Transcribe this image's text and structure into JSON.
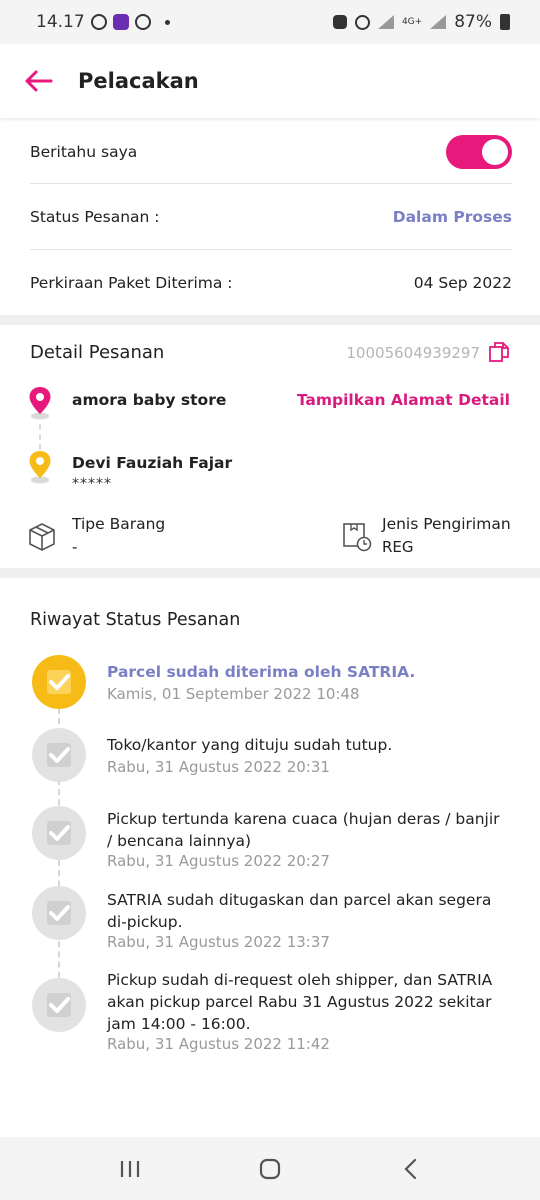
{
  "status_bar": {
    "time": "14.17",
    "network": "4G+",
    "battery": "87%"
  },
  "header": {
    "title": "Pelacakan"
  },
  "notify": {
    "label": "Beritahu saya",
    "enabled": true
  },
  "order_status": {
    "label": "Status Pesanan :",
    "value": "Dalam Proses"
  },
  "estimate": {
    "label": "Perkiraan Paket Diterima :",
    "value": "04 Sep 2022"
  },
  "detail": {
    "title": "Detail Pesanan",
    "order_id": "10005604939297",
    "sender": "amora baby store",
    "address_link": "Tampilkan Alamat Detail",
    "receiver": "Devi Fauziah Fajar",
    "receiver_phone": "*****",
    "item_type_label": "Tipe Barang",
    "item_type_value": "-",
    "shipping_label": "Jenis Pengiriman",
    "shipping_value": "REG"
  },
  "history": {
    "title": "Riwayat Status Pesanan",
    "items": [
      {
        "text": "Parcel sudah diterima oleh SATRIA.",
        "time": "Kamis, 01 September 2022 10:48",
        "active": true
      },
      {
        "text": "Toko/kantor yang dituju sudah tutup.",
        "time": "Rabu, 31 Agustus 2022 20:31",
        "active": false
      },
      {
        "text": "Pickup tertunda karena cuaca (hujan deras / banjir / bencana lainnya)",
        "time": "Rabu, 31 Agustus 2022 20:27",
        "active": false
      },
      {
        "text": "SATRIA sudah ditugaskan dan parcel akan segera di-pickup.",
        "time": "Rabu, 31 Agustus 2022 13:37",
        "active": false
      },
      {
        "text": "Pickup sudah di-request oleh shipper, dan SATRIA akan pickup parcel Rabu 31 Agustus 2022 sekitar jam 14:00 - 16:00.",
        "time": "Rabu, 31 Agustus 2022 11:42",
        "active": false
      }
    ]
  },
  "colors": {
    "accent": "#e8197d",
    "status": "#7b7fc4",
    "active_icon": "#f7bb17"
  }
}
